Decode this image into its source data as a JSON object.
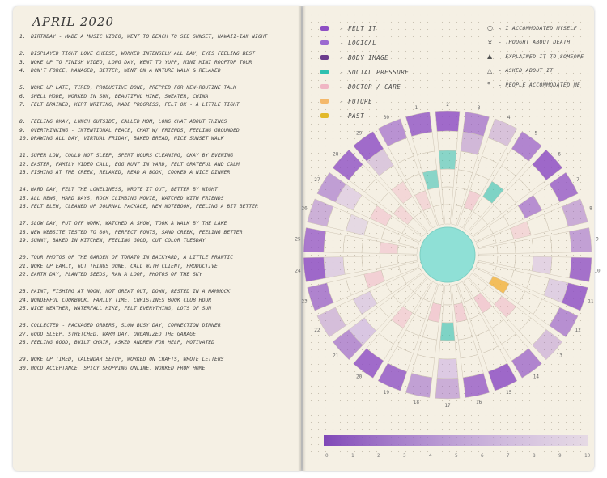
{
  "journal": {
    "left_page": {
      "title": "APRIL 2020",
      "entries": [
        {
          "n": "1",
          "text": "BIRTHDAY - MADE A MUSIC VIDEO, WENT TO BEACH TO SEE SUNSET, HAWAII-IAN NIGHT"
        },
        {
          "n": "2",
          "text": "DISPLAYED TIGHT LOVE CHEESE, WORKED INTENSELY ALL DAY, EYES FEELING BEST"
        },
        {
          "n": "3",
          "text": "WOKE UP TO FINISH VIDEO, LONG DAY, WENT TO YUPP, MINI MINI ROOFTOP TOUR"
        },
        {
          "n": "4",
          "text": "DON'T FORCE, MANAGED, BETTER, WENT ON A NATURE WALK & RELAXED"
        },
        {
          "n": "5",
          "text": "WOKE UP LATE, TIRED, PRODUCTIVE DONE, PREPPED FOR NEW-ROUTINE TALK"
        },
        {
          "n": "6",
          "text": "SHELL MODE, WORKED IN SUN, BEAUTIFUL HIKE, SWEATER, CHINA"
        },
        {
          "n": "7",
          "text": "FELT DRAINED, KEPT WRITING, MADE PROGRESS, FELT OK - A LITTLE TIGHT"
        },
        {
          "n": "8",
          "text": "FEELING OKAY, LUNCH OUTSIDE, CALLED MOM, LONG CHAT ABOUT THINGS"
        },
        {
          "n": "9",
          "text": "OVERTHINKING - INTENTIONAL PEACE, CHAT W/ FRIENDS, FEELING GROUNDED"
        },
        {
          "n": "10",
          "text": "DRAWING ALL DAY, VIRTUAL FRIDAY, BAKED BREAD, NICE SUNSET WALK"
        },
        {
          "n": "11",
          "text": "SUPER LOW, COULD NOT SLEEP, SPENT HOURS CLEANING, OKAY BY EVENING"
        },
        {
          "n": "12",
          "text": "EASTER, FAMILY VIDEO CALL, EGG HUNT IN YARD, FELT GRATEFUL AND CALM"
        },
        {
          "n": "13",
          "text": "FISHING AT THE CREEK, RELAXED, READ A BOOK, COOKED A NICE DINNER"
        },
        {
          "n": "14",
          "text": "HARD DAY, FELT THE LONELINESS, WROTE IT OUT, BETTER BY NIGHT"
        },
        {
          "n": "15",
          "text": "ALL NEWS, HARD DAYS, ROCK CLIMBING MOVIE, WATCHED WITH FRIENDS"
        },
        {
          "n": "16",
          "text": "FELT BLEH, CLEANED UP JOURNAL PACKAGE, NEW NOTEBOOK, FEELING A BIT BETTER"
        },
        {
          "n": "17",
          "text": "SLOW DAY, PUT OFF WORK, WATCHED A SHOW, TOOK A WALK BY THE LAKE"
        },
        {
          "n": "18",
          "text": "NEW WEBSITE TESTED TO 80%, PERFECT FONTS, SAND CREEK, FEELING BETTER"
        },
        {
          "n": "19",
          "text": "SUNNY, BAKED IN KITCHEN, FEELING GOOD, CUT COLOR TUESDAY"
        },
        {
          "n": "20",
          "text": "TOUR PHOTOS OF THE GARDEN OF TOMATO IN BACKYARD, A LITTLE FRANTIC"
        },
        {
          "n": "21",
          "text": "WOKE UP EARLY, GOT THINGS DONE, CALL WITH CLIENT, PRODUCTIVE"
        },
        {
          "n": "22",
          "text": "EARTH DAY, PLANTED SEEDS, RAN A LOOP, PHOTOS OF THE SKY"
        },
        {
          "n": "23",
          "text": "PAINT, FISHING AT NOON, NOT GREAT OUT, DOWN, RESTED IN A HAMMOCK"
        },
        {
          "n": "24",
          "text": "WONDERFUL COOKBOOK, FAMILY TIME, CHRISTINES BOOK CLUB HOUR"
        },
        {
          "n": "25",
          "text": "NICE WEATHER, WATERFALL HIKE, FELT EVERYTHING, LOTS OF SUN"
        },
        {
          "n": "26",
          "text": "COLLECTED - PACKAGED ORDERS, SLOW BUSY DAY, CONNECTION DINNER"
        },
        {
          "n": "27",
          "text": "GOOD SLEEP, STRETCHED, WARM DAY, ORGANIZED THE GARAGE"
        },
        {
          "n": "28",
          "text": "FEELING GOOD, BUILT CHAIR, ASKED ANDREW FOR HELP, MOTIVATED"
        },
        {
          "n": "29",
          "text": "WOKE UP TIRED, CALENDAR SETUP, WORKED ON CRAFTS, WROTE LETTERS"
        },
        {
          "n": "30",
          "text": "MOCO ACCEPTANCE, SPICY SHOPPING ONLINE, WORKED FROM HOME"
        }
      ]
    },
    "right_page": {
      "legend": [
        {
          "label": "- FELT IT",
          "color": "#8e4fc4"
        },
        {
          "label": "- LOGICAL",
          "color": "#9b6ad0"
        },
        {
          "label": "- BODY IMAGE",
          "color": "#6b3c8c"
        },
        {
          "label": "- SOCIAL PRESSURE",
          "color": "#2fc0b0"
        },
        {
          "label": "- DOCTOR / CARE",
          "color": "#f0b6c4"
        },
        {
          "label": "- FUTURE",
          "color": "#f4b86a"
        },
        {
          "label": "- PAST",
          "color": "#e2b92a"
        }
      ],
      "notes": [
        {
          "symbol": "○",
          "label": "- I ACCOMMODATED MYSELF"
        },
        {
          "symbol": "×",
          "label": "- THOUGHT ABOUT DEATH"
        },
        {
          "symbol": "▲",
          "label": "- EXPLAINED IT TO SOMEONE"
        },
        {
          "symbol": "△",
          "label": "- ASKED ABOUT IT"
        },
        {
          "symbol": "*",
          "label": "- PEOPLE ACCOMMODATED ME"
        }
      ],
      "day_labels": [
        "1",
        "2",
        "3",
        "4",
        "5",
        "6",
        "7",
        "8",
        "9",
        "10",
        "11",
        "12",
        "13",
        "14",
        "15",
        "16",
        "17",
        "18",
        "19",
        "20",
        "21",
        "22",
        "23",
        "24",
        "25",
        "26",
        "27",
        "28",
        "29",
        "30"
      ],
      "scale_labels": [
        "0",
        "1",
        "2",
        "3",
        "4",
        "5",
        "6",
        "7",
        "8",
        "9",
        "10"
      ]
    }
  }
}
